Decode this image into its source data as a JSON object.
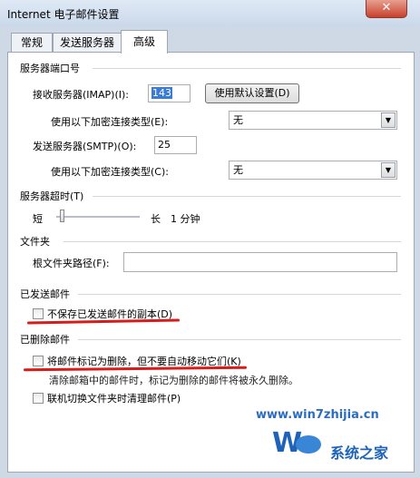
{
  "window": {
    "title": "Internet 电子邮件设置",
    "close_glyph": "✕"
  },
  "tabs": [
    {
      "label": "常规"
    },
    {
      "label": "发送服务器"
    },
    {
      "label": "高级"
    }
  ],
  "ports": {
    "group_label": "服务器端口号",
    "incoming_label": "接收服务器(IMAP)(I):",
    "incoming_value": "143",
    "default_button": "使用默认设置(D)",
    "incoming_encrypt_label": "使用以下加密连接类型(E):",
    "incoming_encrypt_value": "无",
    "outgoing_label": "发送服务器(SMTP)(O):",
    "outgoing_value": "25",
    "outgoing_encrypt_label": "使用以下加密连接类型(C):",
    "outgoing_encrypt_value": "无"
  },
  "timeout": {
    "group_label": "服务器超时(T)",
    "short_label": "短",
    "long_label": "长",
    "value_label": "1 分钟"
  },
  "folders": {
    "group_label": "文件夹",
    "root_label": "根文件夹路径(F):",
    "root_value": ""
  },
  "sent": {
    "group_label": "已发送邮件",
    "dont_save_label": "不保存已发送邮件的副本(D)"
  },
  "deleted": {
    "group_label": "已删除邮件",
    "mark_label": "将邮件标记为删除，但不要自动移动它们(K)",
    "mark_note": "清除邮箱中的邮件时，标记为删除的邮件将被永久删除。",
    "purge_label": "联机切换文件夹时清理邮件(P)"
  },
  "watermark": {
    "site": "www.win7zhijia.cn",
    "brand": "系统之家"
  },
  "colors": {
    "annotation_red": "#d81b1b",
    "watermark_blue": "#2a6cc2"
  }
}
